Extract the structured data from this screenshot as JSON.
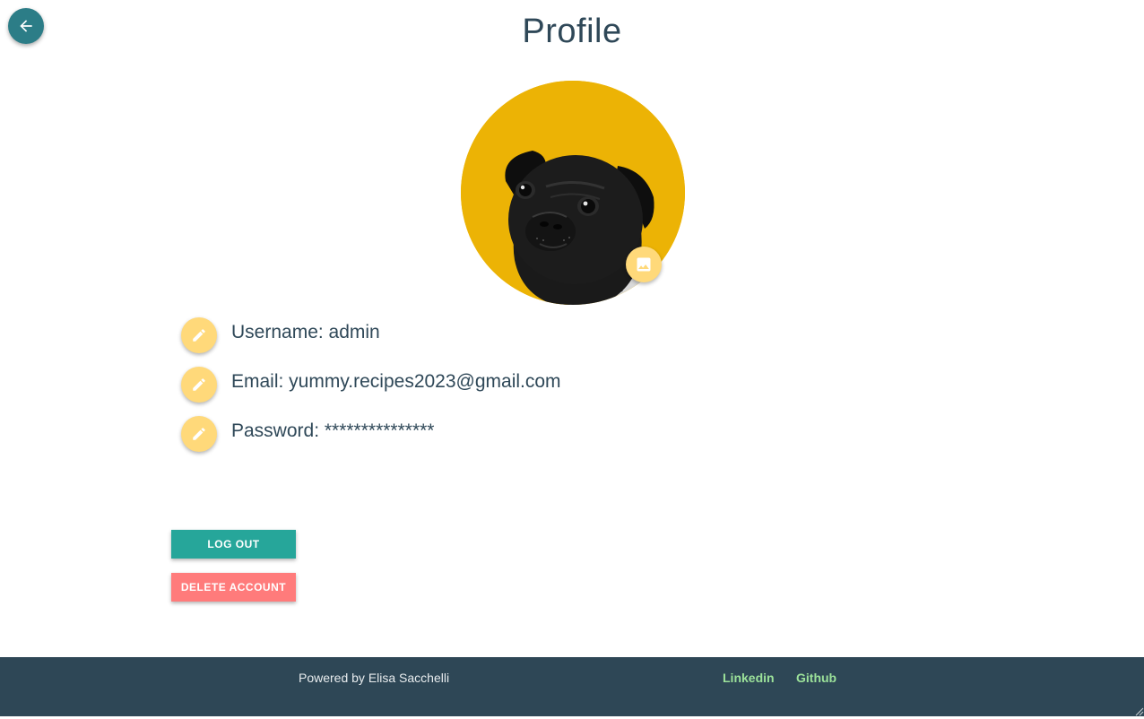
{
  "header": {
    "title": "Profile",
    "back_icon": "arrow-back-icon"
  },
  "avatar": {
    "background_color": "#ecb305",
    "image_subject": "pug-photo",
    "change_photo_icon": "image-icon"
  },
  "profile": {
    "fields": [
      {
        "label": "Username: admin",
        "icon": "pencil-icon"
      },
      {
        "label": "Email: yummy.recipes2023@gmail.com",
        "icon": "pencil-icon"
      },
      {
        "label": "Password: ***************",
        "icon": "pencil-icon"
      }
    ]
  },
  "actions": {
    "logout_label": "LOG OUT",
    "delete_label": "DELETE ACCOUNT",
    "logout_color": "#26a69a",
    "delete_color": "#ff7b7b"
  },
  "footer": {
    "powered_by": "Powered by Elisa Sacchelli",
    "links": [
      "Linkedin",
      "Github"
    ],
    "background_color": "#2e4756",
    "link_color": "#9ce29a"
  }
}
